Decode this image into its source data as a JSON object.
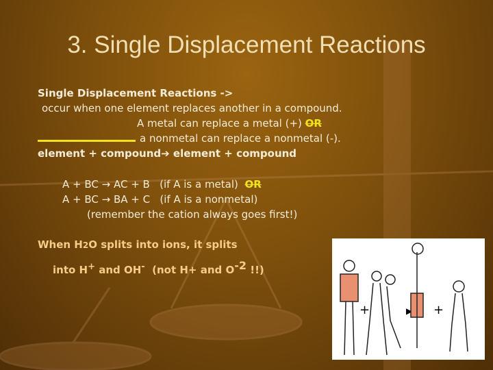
{
  "title": "3. Single Displacement Reactions",
  "body": {
    "heading": "Single Displacement Reactions ->",
    "line1": "occur when one element replaces another in a compound.",
    "line2": "A metal can replace a metal (+)",
    "or": "OR",
    "line3": "a nonmetal can replace a nonmetal (-).",
    "line4a": "element + compound",
    "line4b": " element + compound",
    "eq1": "A + BC → AC + B   (if A is a metal)",
    "eq2": "A + BC → BA + C   (if A is a nonmetal)",
    "eq3": "(remember the cation always goes first!)"
  },
  "water": {
    "line1a": "When H",
    "line1sub": "2",
    "line1b": "O splits into ions, it splits",
    "into": "into H",
    "plus": "+",
    "and_oh": " and OH",
    "minus": "-",
    "not": "  (not H+ and O",
    "neg2": "-2",
    "end": " !!)"
  },
  "colors": {
    "accent": "#f2e21a",
    "text": "#f6ecd6",
    "highlight": "#f6cc88"
  }
}
